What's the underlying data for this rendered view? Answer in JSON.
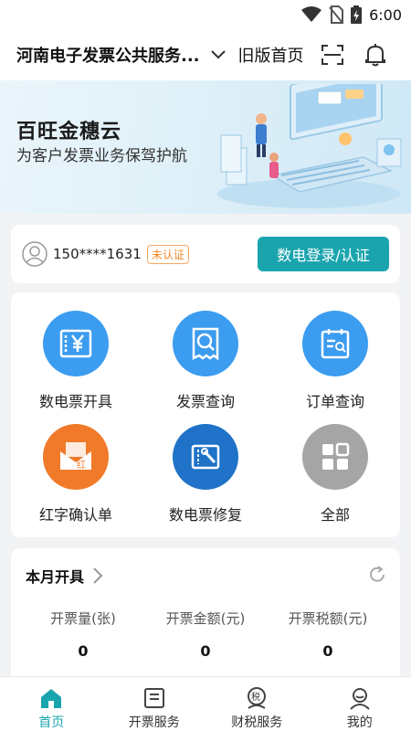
{
  "status_bar": {
    "time": "6:00"
  },
  "header": {
    "title": "河南电子发票公共服务...",
    "old_version": "旧版首页"
  },
  "banner": {
    "title": "百旺金穗云",
    "subtitle": "为客户发票业务保驾护航"
  },
  "user": {
    "phone": "150****1631",
    "status_badge": "未认证",
    "login_button": "数电登录/认证"
  },
  "grid": {
    "items": [
      {
        "label": "数电票开具",
        "icon": "invoice-yuan-icon",
        "color": "#3b9cf0"
      },
      {
        "label": "发票查询",
        "icon": "invoice-search-icon",
        "color": "#3b9cf0"
      },
      {
        "label": "订单查询",
        "icon": "order-search-icon",
        "color": "#3b9cf0"
      },
      {
        "label": "红字确认单",
        "icon": "red-letter-icon",
        "color": "#f07a2a"
      },
      {
        "label": "数电票修复",
        "icon": "repair-icon",
        "color": "#1f72c8"
      },
      {
        "label": "全部",
        "icon": "all-apps-icon",
        "color": "#a5a5a5"
      }
    ]
  },
  "monthly": {
    "title": "本月开具",
    "stats": [
      {
        "label": "开票量(张)",
        "value": "0"
      },
      {
        "label": "开票金额(元)",
        "value": "0"
      },
      {
        "label": "开票税额(元)",
        "value": "0"
      }
    ]
  },
  "tabbar": {
    "tabs": [
      {
        "label": "首页",
        "icon": "home-icon"
      },
      {
        "label": "开票服务",
        "icon": "invoice-service-icon"
      },
      {
        "label": "财税服务",
        "icon": "tax-service-icon"
      },
      {
        "label": "我的",
        "icon": "profile-icon"
      }
    ],
    "active": "首页"
  },
  "colors": {
    "accent": "#1aa5ae",
    "badge": "#f08a2b"
  }
}
